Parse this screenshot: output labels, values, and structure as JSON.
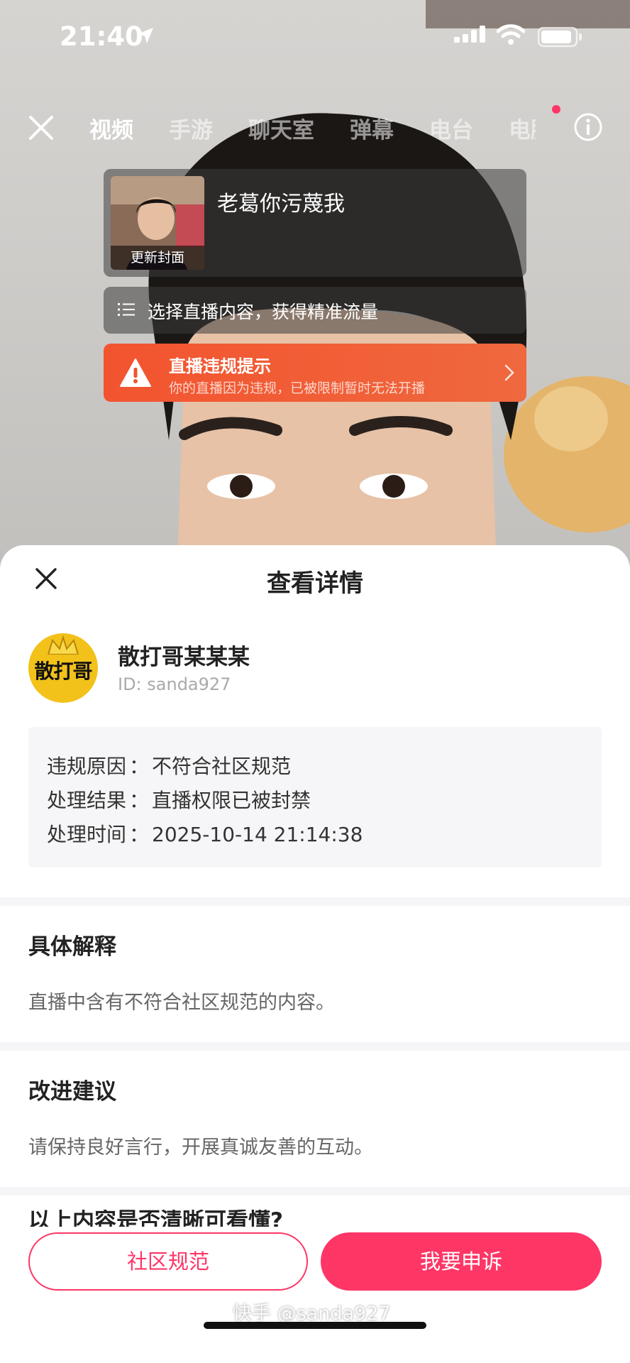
{
  "status_bar": {
    "time": "21:40"
  },
  "top_tabs": {
    "items": [
      "视频",
      "手游",
      "聊天室",
      "弹幕",
      "电台",
      "电脑"
    ],
    "active_index": 0
  },
  "live_setup": {
    "cover_label": "更新封面",
    "live_title": "老葛你污蔑我",
    "content_prompt": "选择直播内容，获得精准流量",
    "violation_banner": {
      "title": "直播违规提示",
      "subtitle": "你的直播因为违规，已被限制暂时无法开播"
    }
  },
  "sheet": {
    "title": "查看详情",
    "profile": {
      "avatar_text": "散打哥",
      "nickname": "散打哥某某某",
      "id": "ID: sanda927"
    },
    "details": [
      {
        "label": "违规原因",
        "sep": "：",
        "value": "不符合社区规范"
      },
      {
        "label": "处理结果",
        "sep": "：",
        "value": "直播权限已被封禁"
      },
      {
        "label": "处理时间",
        "sep": "：",
        "value": "2025-10-14 21:14:38"
      }
    ],
    "sections": [
      {
        "title": "具体解释",
        "body": "直播中含有不符合社区规范的内容。"
      },
      {
        "title": "改进建议",
        "body": "请保持良好言行，开展真诚友善的互动。"
      }
    ],
    "truncated_section_title": "以上内容是否清晰可看懂?"
  },
  "buttons": {
    "community_rules": "社区规范",
    "appeal": "我要申诉"
  },
  "watermark": "快手 @sanda927",
  "colors": {
    "brand_pink": "#fe3666",
    "warning_orange": "#f2542f",
    "avatar_yellow": "#f2c21b"
  }
}
